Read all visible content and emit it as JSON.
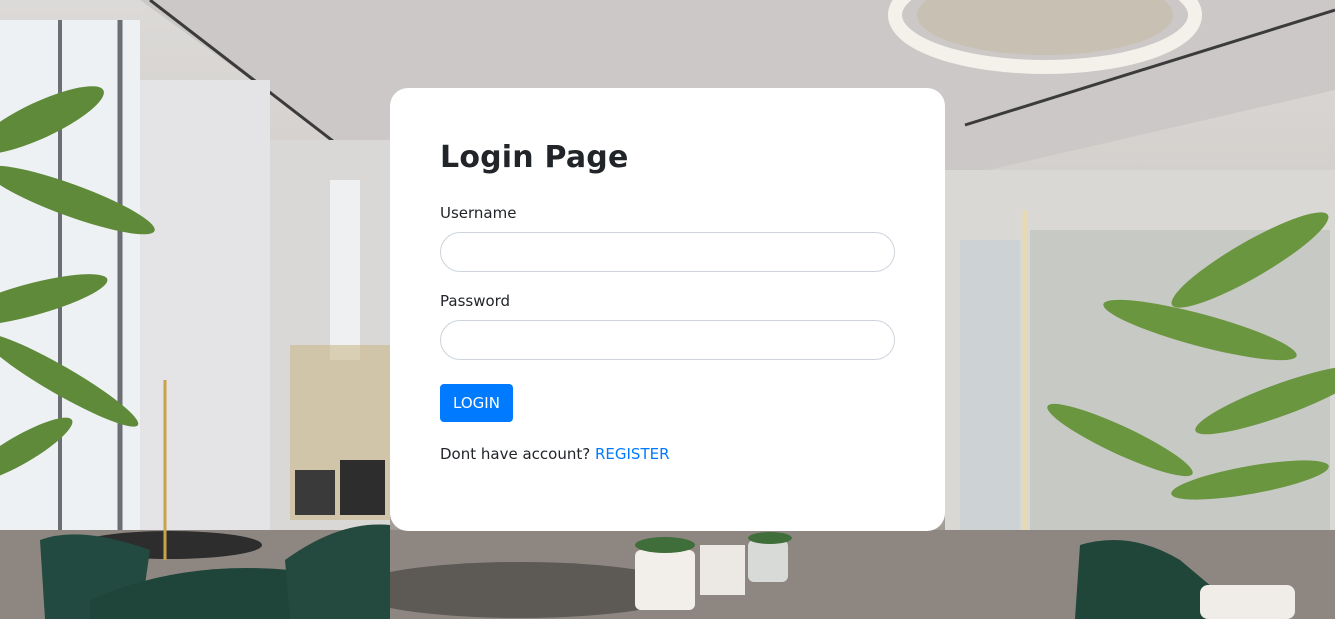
{
  "login": {
    "title": "Login Page",
    "username_label": "Username",
    "username_value": "",
    "password_label": "Password",
    "password_value": "",
    "login_button": "LOGIN",
    "footer_text": "Dont have account?",
    "register_link": "REGISTER"
  },
  "colors": {
    "accent": "#007bff",
    "card_bg": "#ffffff",
    "text": "#212529"
  }
}
